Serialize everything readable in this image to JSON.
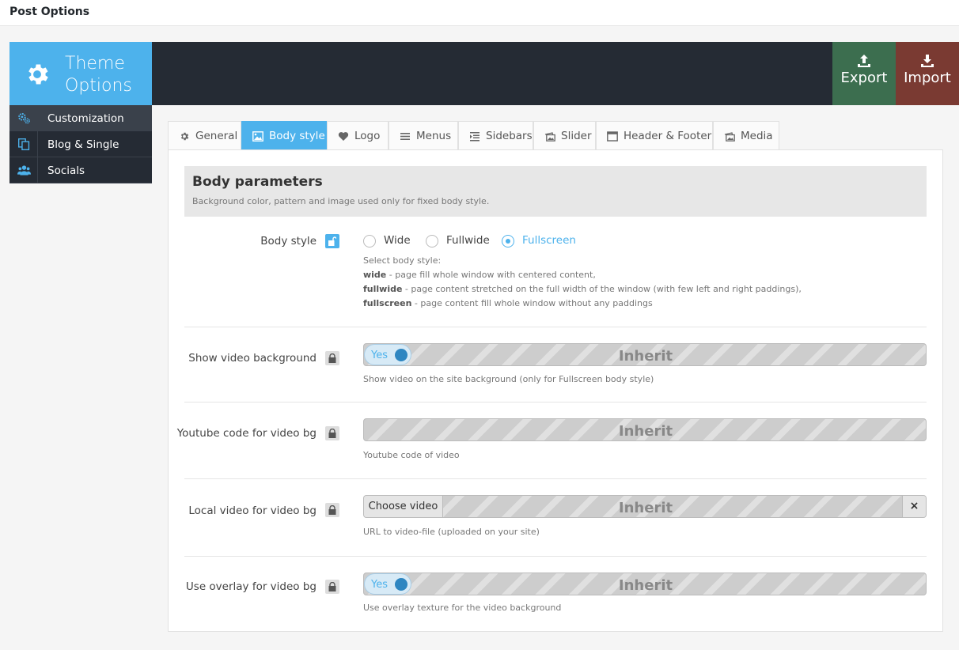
{
  "page": {
    "title": "Post Options"
  },
  "brand": {
    "title": "Theme Options"
  },
  "actions": {
    "export_label": "Export",
    "import_label": "Import"
  },
  "sidebar": {
    "items": [
      {
        "label": "Customization",
        "icon": "gears-icon",
        "active": true
      },
      {
        "label": "Blog & Single",
        "icon": "copy-icon",
        "active": false
      },
      {
        "label": "Socials",
        "icon": "users-icon",
        "active": false
      }
    ]
  },
  "tabs": [
    {
      "label": "General",
      "icon": "gear-icon"
    },
    {
      "label": "Body style",
      "icon": "image-icon",
      "active": true
    },
    {
      "label": "Logo",
      "icon": "heart-icon"
    },
    {
      "label": "Menus",
      "icon": "menu-icon"
    },
    {
      "label": "Sidebars",
      "icon": "indent-icon"
    },
    {
      "label": "Slider",
      "icon": "gallery-icon"
    },
    {
      "label": "Header & Footer",
      "icon": "window-icon"
    },
    {
      "label": "Media",
      "icon": "gallery-icon"
    }
  ],
  "section": {
    "title": "Body parameters",
    "description": "Background color, pattern and image used only for fixed body style."
  },
  "fields": {
    "body_style": {
      "label": "Body style",
      "options": [
        "Wide",
        "Fullwide",
        "Fullscreen"
      ],
      "selected": "Fullscreen",
      "desc_intro": "Select body style:",
      "desc_lines": [
        {
          "key": "wide",
          "text": " - page fill whole window with centered content,"
        },
        {
          "key": "fullwide",
          "text": " - page content stretched on the full width of the window (with few left and right paddings),"
        },
        {
          "key": "fullscreen",
          "text": " - page content fill whole window without any paddings"
        }
      ]
    },
    "show_video_bg": {
      "label": "Show video background",
      "switch_value": "Yes",
      "inherit": "Inherit",
      "desc": "Show video on the site background (only for Fullscreen body style)"
    },
    "youtube_code": {
      "label": "Youtube code for video bg",
      "inherit": "Inherit",
      "desc": "Youtube code of video"
    },
    "local_video": {
      "label": "Local video for video bg",
      "button": "Choose video",
      "inherit": "Inherit",
      "clear": "×",
      "desc": "URL to video-file (uploaded on your site)"
    },
    "use_overlay": {
      "label": "Use overlay for video bg",
      "switch_value": "Yes",
      "inherit": "Inherit",
      "desc": "Use overlay texture for the video background"
    }
  },
  "colors": {
    "accent": "#4db2ec",
    "dark": "#252b34",
    "export": "#3c6e4f",
    "import": "#7a3a32"
  }
}
